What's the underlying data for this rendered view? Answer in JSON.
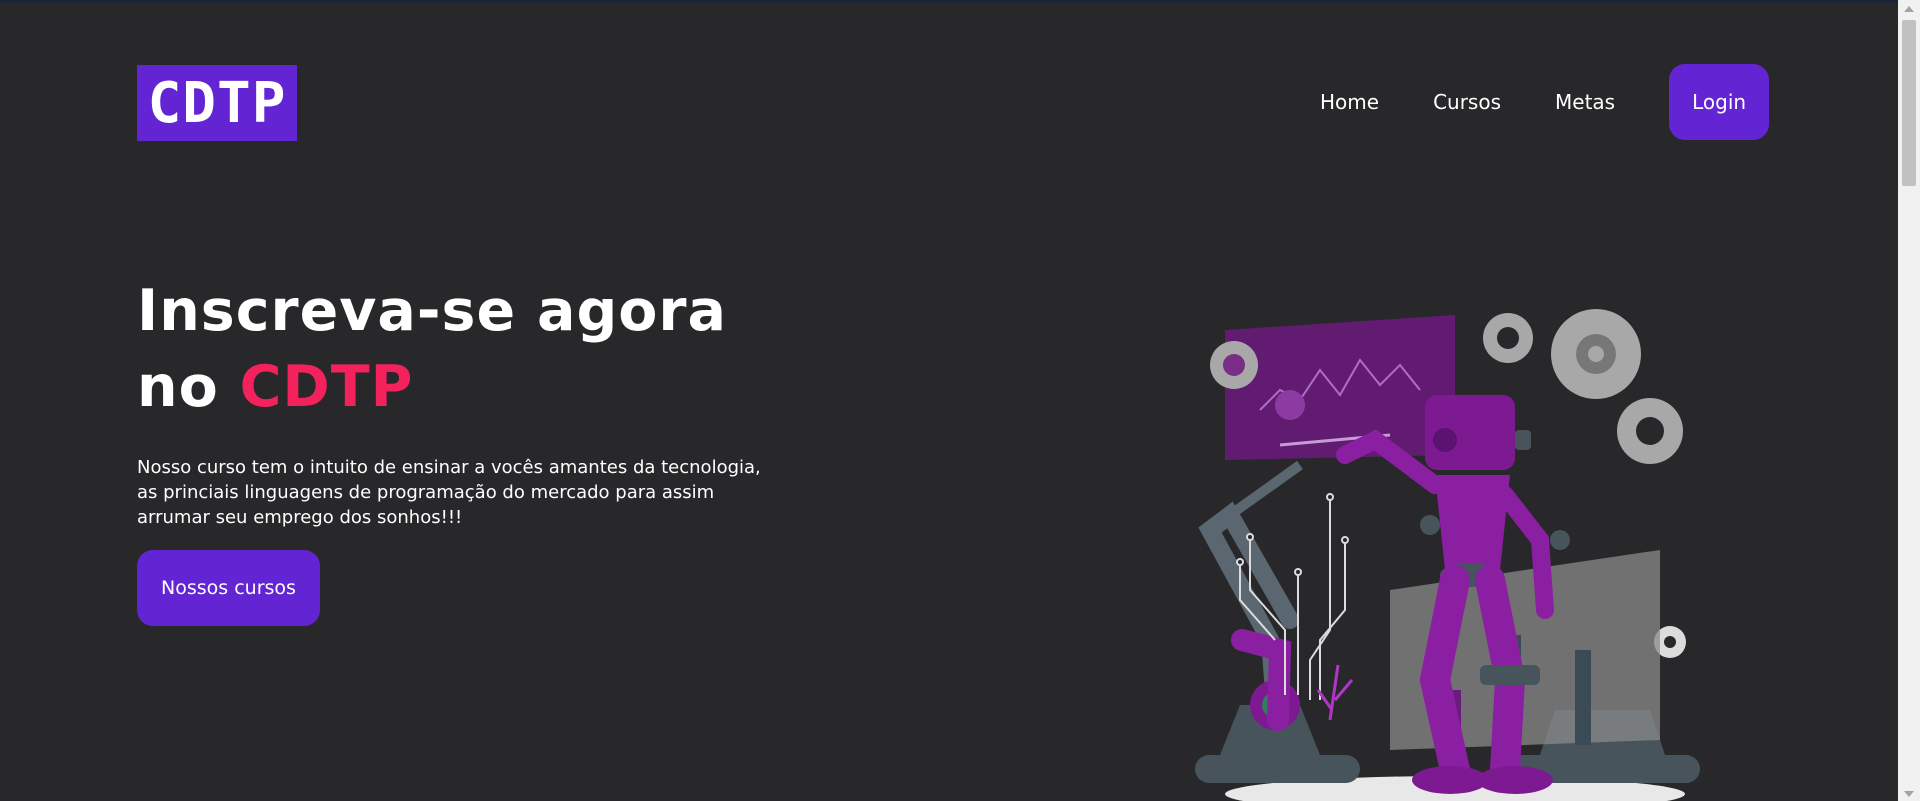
{
  "header": {
    "logo_text": "CDTP",
    "nav": [
      {
        "label": "Home"
      },
      {
        "label": "Cursos"
      },
      {
        "label": "Metas"
      }
    ],
    "login_label": "Login"
  },
  "hero": {
    "title_line1": "Inscreva-se agora",
    "title_line2_prefix": "no ",
    "title_accent": "CDTP",
    "description": "Nosso curso tem o intuito de ensinar a vocês amantes da tecnologia, as princiais linguagens de programação do mercado para assim arrumar seu emprego dos sonhos!!!",
    "cta_label": "Nossos cursos"
  },
  "colors": {
    "background": "#28282b",
    "brand_purple": "#6325d4",
    "accent_pink": "#f3225d"
  },
  "illustration": {
    "icon": "robot-gears-illustration"
  }
}
